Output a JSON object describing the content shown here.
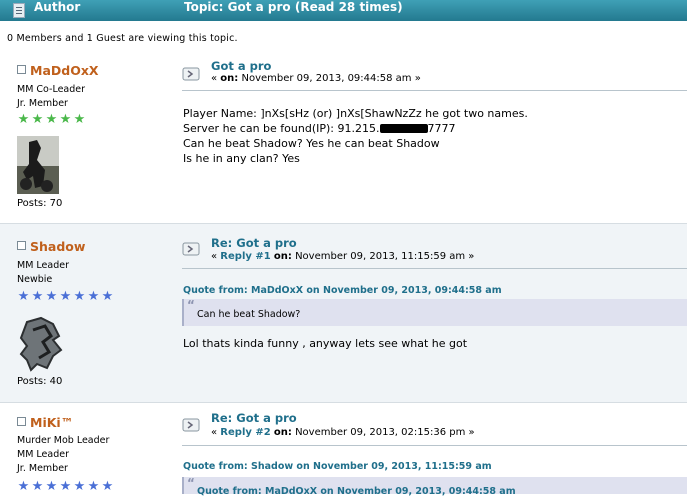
{
  "header": {
    "author_label": "Author",
    "topic_label": "Topic: Got a pro  (Read 28 times)"
  },
  "viewers_text": "0 Members and 1 Guest are viewing this topic.",
  "posts": [
    {
      "author": "MaDdOxX",
      "groups": [
        "MM Co-Leader",
        "Jr. Member"
      ],
      "stars": 5,
      "star_color": "#4ab84a",
      "posts_count": "Posts: 70",
      "title": "Got a pro",
      "date_prefix": "« ",
      "date_on": "on:",
      "date": " November 09, 2013, 09:44:58 am »",
      "body_lines": [
        "Player Name: ]nXs[sHz (or) ]nXs[ShawNzZz  he got two names.",
        "Server he can be found(IP): 91.215.",
        "7777",
        "Can he beat Shadow? Yes he can beat Shadow",
        "Is he in any clan? Yes"
      ]
    },
    {
      "author": "Shadow",
      "groups": [
        "MM Leader",
        "Newbie"
      ],
      "stars": 7,
      "star_color": "#4a6fd6",
      "posts_count": "Posts: 40",
      "title": "Re: Got a pro",
      "reply": "Reply #1",
      "date_prefix": "« ",
      "date_on": "on:",
      "date": " November 09, 2013, 11:15:59 am »",
      "quote_head": "Quote from: MaDdOxX on November 09, 2013, 09:44:58 am",
      "quote_text": "Can he beat Shadow?",
      "body": "Lol thats kinda funny , anyway lets see what he got"
    },
    {
      "author": "MiKi™",
      "groups": [
        "Murder Mob Leader",
        "MM Leader",
        "Jr. Member"
      ],
      "stars": 7,
      "star_color": "#4a6fd6",
      "title": "Re: Got a pro",
      "reply": "Reply #2",
      "date_prefix": "« ",
      "date_on": "on:",
      "date": " November 09, 2013, 02:15:36 pm »",
      "quote_head": "Quote from: Shadow on November 09, 2013, 11:15:59 am",
      "quote_text": "Quote from: MaDdOxX on November 09, 2013, 09:44:58 am"
    }
  ]
}
